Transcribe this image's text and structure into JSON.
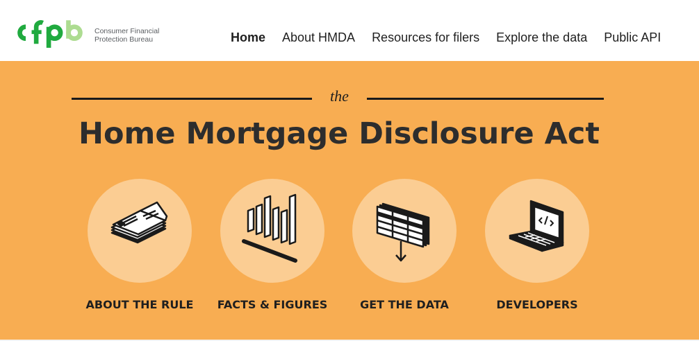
{
  "header": {
    "logo": {
      "mark_text": "cfpb",
      "line1": "Consumer Financial",
      "line2": "Protection Bureau"
    },
    "nav": [
      {
        "label": "Home",
        "active": true
      },
      {
        "label": "About HMDA"
      },
      {
        "label": "Resources for filers"
      },
      {
        "label": "Explore the data"
      },
      {
        "label": "Public API"
      }
    ]
  },
  "hero": {
    "kicker": "the",
    "title": "Home Mortgage Disclosure Act",
    "background_color": "#f8ad52",
    "circle_color": "#fbcd93",
    "cards": [
      {
        "label": "ABOUT THE RULE",
        "icon": "open-book-icon"
      },
      {
        "label": "FACTS & FIGURES",
        "icon": "bar-chart-icon"
      },
      {
        "label": "GET THE DATA",
        "icon": "spreadsheet-download-icon"
      },
      {
        "label": "DEVELOPERS",
        "icon": "laptop-code-icon"
      }
    ]
  },
  "colors": {
    "logo_green": "#20aa3f",
    "logo_light_green": "#addc91",
    "text_dark": "#2d2d2d"
  }
}
